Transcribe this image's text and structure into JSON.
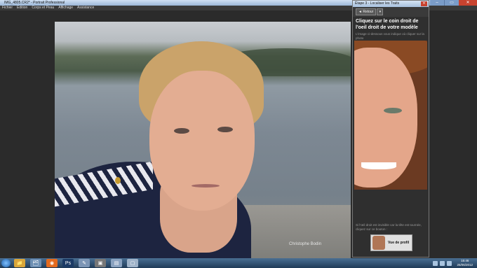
{
  "window": {
    "title": "IMG_4805.CR2* - Portrait Professional",
    "controls": {
      "minimize": "–",
      "maximize": "▭",
      "close": "✕"
    }
  },
  "menu": [
    "Fichier",
    "Edition",
    "Corps et Peau",
    "Affichage",
    "Assistance"
  ],
  "photo": {
    "watermark": "Christophe Bodin"
  },
  "panel": {
    "title": "Étape 3 - Localiser les Traits",
    "close": "✕",
    "back_label": "◄ Retour",
    "back_dropdown": "▾",
    "heading": "Cliquez sur le coin droit de l'oeil droit de votre modèle",
    "instruction": "L'image ci-dessous vous indique où cliquer sur la photo",
    "hint": "Si l'œil droit est invisible car la tête est tournée, cliquez sur ce bouton :",
    "profile_button": "Vue de profil"
  },
  "taskbar": {
    "apps": [
      {
        "icon": "explorer-icon",
        "glyph": "📁",
        "color": "#d9a63a"
      },
      {
        "icon": "libraries-icon",
        "glyph": "🗂",
        "color": "#6d8fb3"
      },
      {
        "icon": "firefox-icon",
        "glyph": "◉",
        "color": "#e36a1e"
      },
      {
        "icon": "photoshop-icon",
        "glyph": "Ps",
        "color": "#1c3b66"
      },
      {
        "icon": "feather-icon",
        "glyph": "✎",
        "color": "#7c95b5"
      },
      {
        "icon": "media-icon",
        "glyph": "▣",
        "color": "#777"
      },
      {
        "icon": "document-icon",
        "glyph": "▤",
        "color": "#8aa2c0"
      },
      {
        "icon": "window-icon",
        "glyph": "▢",
        "color": "#9fb3c9"
      }
    ],
    "time": "15:46",
    "date": "25/06/2012"
  }
}
